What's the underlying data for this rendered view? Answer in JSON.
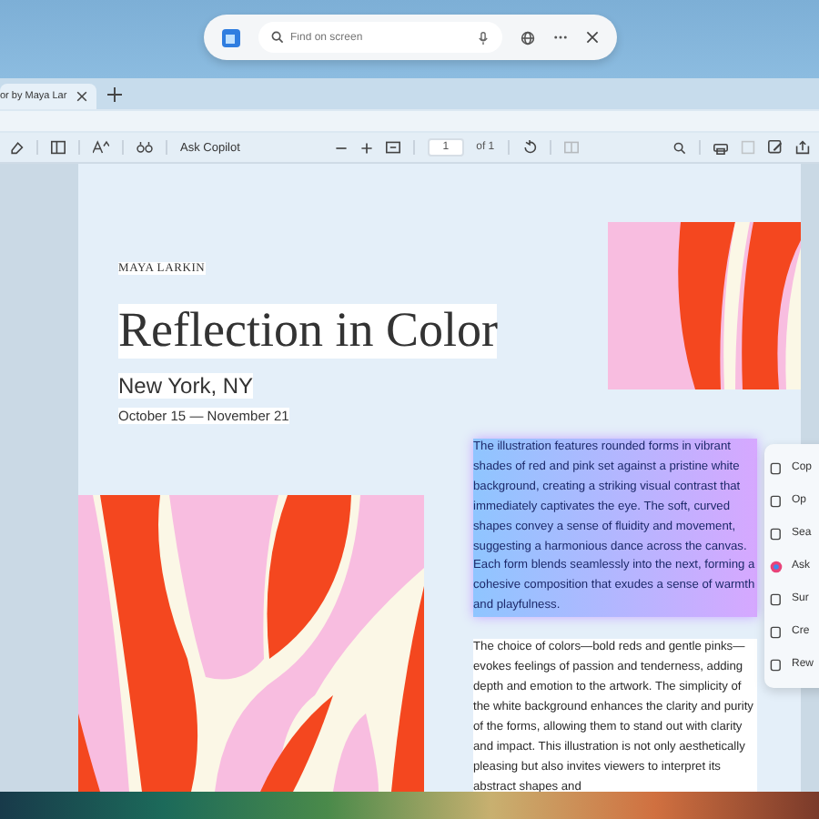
{
  "find_bar": {
    "placeholder": "Find on screen"
  },
  "tabs": [
    {
      "title": "or by Maya Lar",
      "selected": true
    }
  ],
  "toolbar": {
    "ask_label": "Ask Copilot",
    "page_number": "1",
    "page_count": "of 1"
  },
  "document": {
    "author": "MAYA LARKIN",
    "title": "Reflection in Color",
    "location": "New York, NY",
    "dates": "October 15 — November 21",
    "paragraphs": [
      {
        "text": "The illustration features rounded forms in vibrant shades of red and pink set against a pristine white background, creating a striking visual contrast that immediately captivates the eye. The soft, curved shapes convey a sense of fluidity and movement, suggesting a harmonious dance across the canvas. Each form blends seamlessly into the next, forming a cohesive composition that exudes a sense of warmth and playfulness.",
        "selected": true
      },
      {
        "text": "The choice of colors—bold reds and gentle pinks—evokes feelings of passion and tenderness, adding depth and emotion to the artwork. The simplicity of the white background enhances the clarity and purity of the forms, allowing them to stand out with clarity and impact. This illustration is not only aesthetically pleasing but also invites viewers to interpret its abstract shapes and",
        "selected": false
      }
    ]
  },
  "context_menu": {
    "items": [
      {
        "label": "Cop"
      },
      {
        "label": "Op"
      },
      {
        "label": "Sea"
      },
      {
        "label": "Ask"
      },
      {
        "label": "Sur"
      },
      {
        "label": "Cre"
      },
      {
        "label": "Rew"
      }
    ]
  }
}
